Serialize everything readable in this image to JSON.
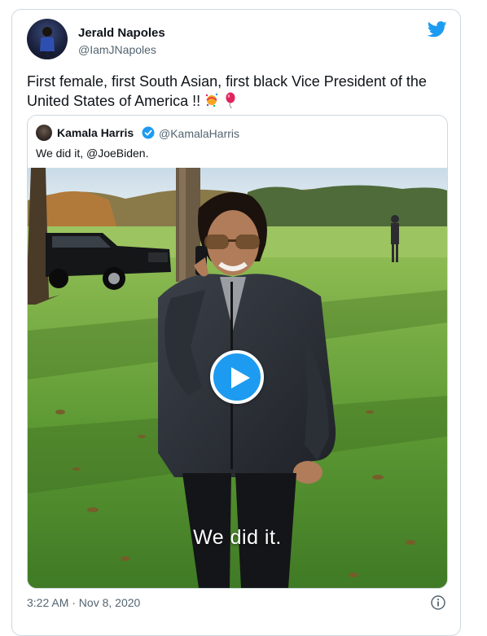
{
  "tweet": {
    "author_name": "Jerald Napoles",
    "author_handle": "@IamJNapoles",
    "text": "First female, first South Asian, first black Vice President of the United States of America !!",
    "emojis": [
      "confetti-ball-emoji",
      "balloon-emoji"
    ],
    "timestamp": "3:22 AM · Nov 8, 2020"
  },
  "quoted": {
    "author_name": "Kamala Harris",
    "author_handle": "@KamalaHarris",
    "verified": true,
    "text": "We did it, @JoeBiden.",
    "video_caption": "We did it."
  },
  "icons": {
    "brand": "twitter-bird-icon",
    "play": "play-icon",
    "info": "info-icon",
    "verified": "verified-badge-icon"
  },
  "colors": {
    "accent": "#1d9bf0",
    "text": "#0f1419",
    "secondary": "#536471",
    "border": "#cfd9de"
  }
}
